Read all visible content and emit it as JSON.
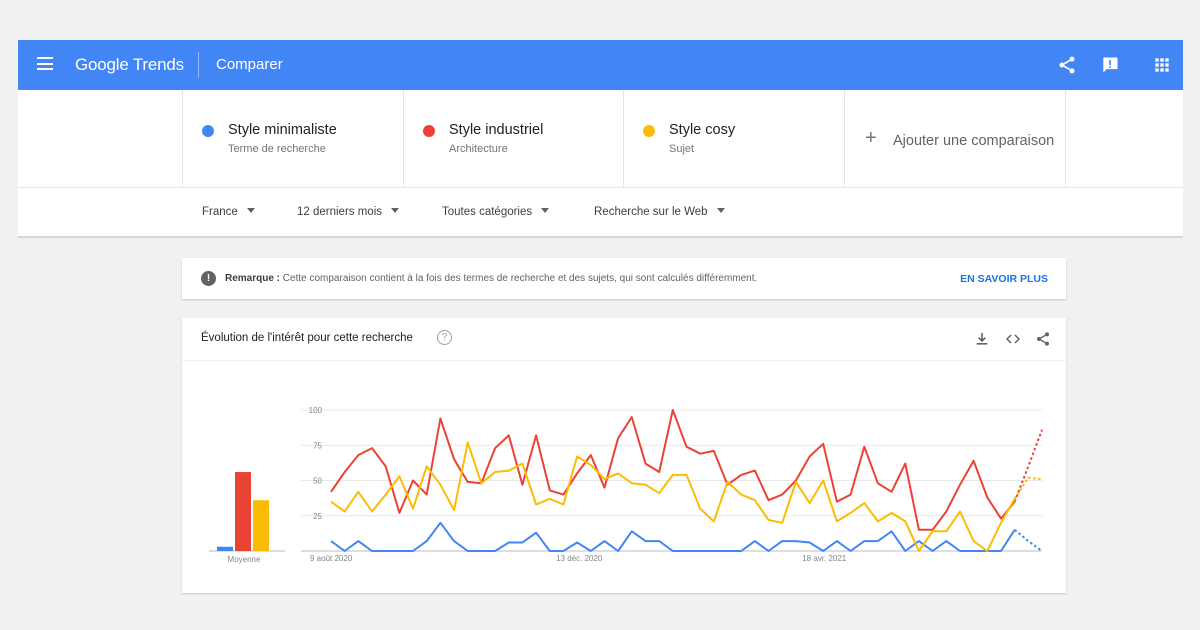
{
  "appbar": {
    "brand": "Google Trends",
    "page_title": "Comparer",
    "icons": [
      "menu-icon",
      "share-icon",
      "feedback-icon",
      "apps-icon"
    ]
  },
  "terms": [
    {
      "name": "Style minimaliste",
      "type": "Terme de recherche",
      "color": "#4285f4"
    },
    {
      "name": "Style industriel",
      "type": "Architecture",
      "color": "#ea4335"
    },
    {
      "name": "Style cosy",
      "type": "Sujet",
      "color": "#fbbc04"
    }
  ],
  "add_comparison": {
    "plus": "+",
    "label": "Ajouter une comparaison"
  },
  "filters": {
    "region": "France",
    "period": "12 derniers mois",
    "category": "Toutes catégories",
    "search_type": "Recherche sur le Web"
  },
  "note": {
    "label": "Remarque :",
    "text": "Cette comparaison contient à la fois des termes de recherche et des sujets, qui sont calculés différemment.",
    "link": "EN SAVOIR PLUS",
    "info_glyph": "!"
  },
  "card": {
    "title": "Évolution de l'intérêt pour cette recherche",
    "help_glyph": "?",
    "icons": [
      "download-icon",
      "embed-icon",
      "share-icon"
    ]
  },
  "chart_data": {
    "type": "line",
    "yticks": [
      25,
      50,
      75,
      100
    ],
    "ylim": [
      0,
      100
    ],
    "xlabels": [
      {
        "index": 0,
        "label": "9 août 2020"
      },
      {
        "index": 18,
        "label": "13 déc. 2020"
      },
      {
        "index": 36,
        "label": "18 avr. 2021"
      }
    ],
    "grid": true,
    "partial_points": 2,
    "averages": {
      "label": "Moyenne",
      "values": [
        3,
        56,
        36
      ]
    },
    "series": [
      {
        "name": "Style minimaliste",
        "color": "#4285f4",
        "values": [
          7,
          0,
          7,
          0,
          0,
          0,
          0,
          7,
          20,
          7,
          0,
          0,
          0,
          6,
          6,
          13,
          0,
          0,
          6,
          0,
          7,
          0,
          14,
          7,
          7,
          0,
          0,
          0,
          0,
          0,
          0,
          7,
          0,
          7,
          7,
          6,
          0,
          7,
          0,
          7,
          7,
          14,
          0,
          7,
          0,
          7,
          0,
          0,
          0,
          0,
          15,
          7,
          0
        ]
      },
      {
        "name": "Style industriel",
        "color": "#ea4335",
        "values": [
          42,
          56,
          68,
          73,
          60,
          27,
          50,
          40,
          94,
          65,
          49,
          48,
          73,
          82,
          47,
          82,
          43,
          40,
          55,
          68,
          45,
          80,
          95,
          62,
          56,
          100,
          74,
          69,
          71,
          47,
          54,
          57,
          36,
          40,
          50,
          67,
          76,
          35,
          40,
          74,
          48,
          42,
          62,
          15,
          15,
          28,
          47,
          64,
          38,
          23,
          35,
          60,
          86
        ]
      },
      {
        "name": "Style cosy",
        "color": "#fbbc04",
        "values": [
          35,
          28,
          42,
          28,
          40,
          53,
          30,
          60,
          47,
          29,
          77,
          48,
          56,
          57,
          62,
          33,
          37,
          33,
          67,
          61,
          51,
          55,
          48,
          47,
          41,
          54,
          54,
          30,
          21,
          49,
          40,
          36,
          22,
          20,
          49,
          34,
          50,
          21,
          27,
          34,
          21,
          27,
          21,
          0,
          14,
          14,
          28,
          7,
          0,
          20,
          37,
          52,
          51
        ]
      }
    ]
  }
}
